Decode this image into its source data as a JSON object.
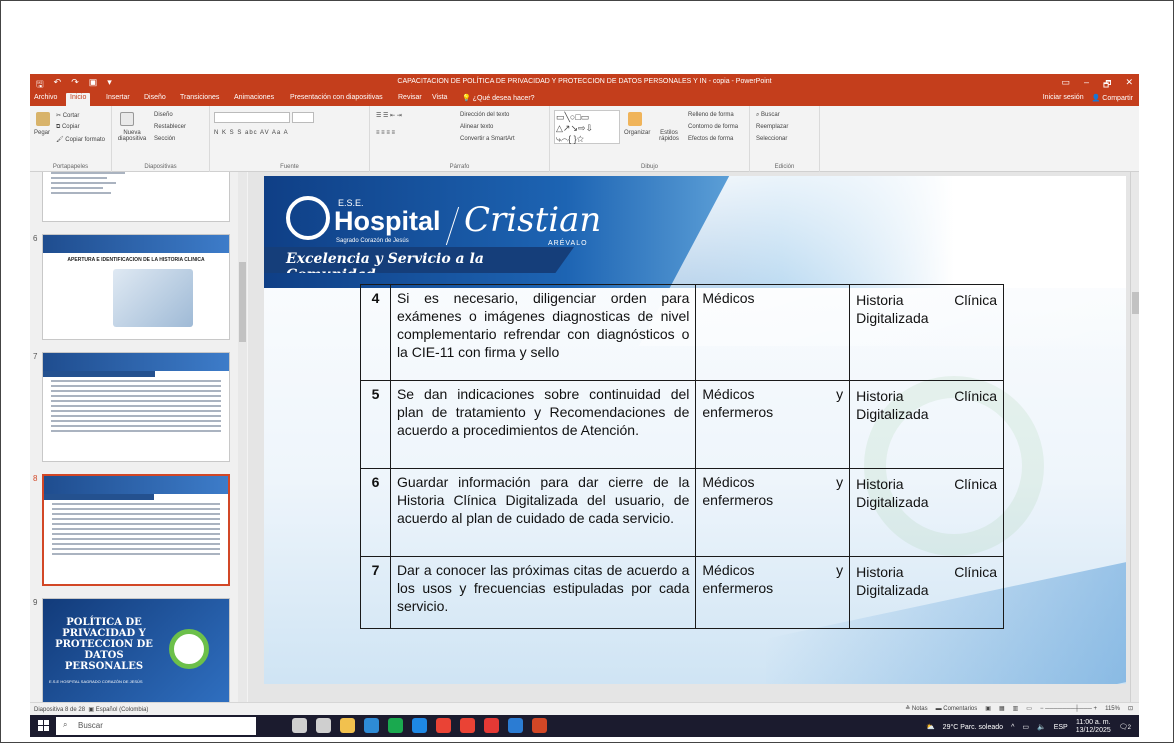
{
  "titlebar": {
    "title": "CAPACITACION DE POLÍTICA DE PRIVACIDAD Y PROTECCION DE DATOS PERSONALES Y IN - copia - PowerPoint",
    "window_controls": [
      "▭",
      "–",
      "🗗",
      "✕"
    ]
  },
  "tabs": {
    "items": [
      "Archivo",
      "Inicio",
      "Insertar",
      "Diseño",
      "Transiciones",
      "Animaciones",
      "Presentación con diapositivas",
      "Revisar",
      "Vista",
      "¿Qué desea hacer?"
    ],
    "signin": "Iniciar sesión",
    "share": "Compartir"
  },
  "ribbon": {
    "clipboard": {
      "paste": "Pegar",
      "cut": "Cortar",
      "copy": "Copiar",
      "format_painter": "Copiar formato",
      "label": "Portapapeles"
    },
    "slides": {
      "new_slide": "Nueva diapositiva",
      "layout": "Diseño",
      "reset": "Restablecer",
      "section": "Sección",
      "label": "Diapositivas"
    },
    "font": {
      "label": "Fuente",
      "format_row": "N K S S abc AV Aa A"
    },
    "paragraph": {
      "label": "Párrafo",
      "text_direction": "Dirección del texto",
      "align_text": "Alinear texto",
      "smartart": "Convertir a SmartArt"
    },
    "drawing": {
      "label": "Dibujo",
      "arrange": "Organizar",
      "quick_styles": "Estilos rápidos",
      "fill": "Relleno de forma",
      "outline": "Contorno de forma",
      "effects": "Efectos de forma"
    },
    "editing": {
      "label": "Edición",
      "find": "Buscar",
      "replace": "Reemplazar",
      "select": "Seleccionar"
    }
  },
  "thumbnails": [
    {
      "num": "6",
      "title": "APERTURA E IDENTIFICACION DE LA HISTORIA CLINICA"
    },
    {
      "num": "7",
      "title": ""
    },
    {
      "num": "8",
      "title": ""
    },
    {
      "num": "9",
      "title": "POLÍTICA DE PRIVACIDAD Y PROTECCION DE DATOS PERSONALES",
      "footer": "E.S.E HOSPITAL SAGRADO CORAZÓN DE JESÚS"
    }
  ],
  "slide": {
    "logo": {
      "ese": "E.S.E.",
      "hospital": "Hospital",
      "subtitle": "Sagrado Corazón de Jesús",
      "script": "Cristian",
      "arevalo": "ARÉVALO"
    },
    "tagline": "Excelencia y Servicio a la Comunidad",
    "rows": [
      {
        "num": "4",
        "activity": "Si es necesario, diligenciar orden para exámenes o imágenes diagnosticas de nivel complementario refrendar con diagnósticos o la CIE-11 con firma y sello",
        "resp_a": "Médicos",
        "resp_b": "",
        "resp_c": "",
        "doc_a": "Historia",
        "doc_b": "Clínica",
        "doc_c": "Digitalizada"
      },
      {
        "num": "5",
        "activity": "Se dan indicaciones sobre continuidad del plan de tratamiento y Recomendaciones de acuerdo a procedimientos de Atención.",
        "resp_a": "Médicos",
        "resp_b": "y",
        "resp_c": "enfermeros",
        "doc_a": "Historia",
        "doc_b": "Clínica",
        "doc_c": "Digitalizada"
      },
      {
        "num": "6",
        "activity": "Guardar información para dar cierre de la Historia Clínica Digitalizada del usuario, de acuerdo al plan de cuidado de cada servicio.",
        "resp_a": "Médicos",
        "resp_b": "y",
        "resp_c": "enfermeros",
        "doc_a": "Historia",
        "doc_b": "Clínica",
        "doc_c": "Digitalizada"
      },
      {
        "num": "7",
        "activity": "Dar a conocer las próximas citas de acuerdo a los usos y frecuencias estipuladas por cada servicio.",
        "resp_a": "Médicos",
        "resp_b": "y",
        "resp_c": "enfermeros",
        "doc_a": "Historia",
        "doc_b": "Clínica",
        "doc_c": "Digitalizada"
      }
    ]
  },
  "statusbar": {
    "slide_info": "Diapositiva 8 de 28",
    "language": "Español (Colombia)",
    "notes": "Notas",
    "comments": "Comentarios",
    "zoom": "115%"
  },
  "taskbar": {
    "search_placeholder": "Buscar",
    "weather": "29°C Parc. soleado",
    "lang": "ESP",
    "time": "11:00 a. m.",
    "date": "13/12/2025",
    "notif_count": "2",
    "app_colors": [
      "#cfcfcf",
      "#cfcfcf",
      "#f2c14e",
      "#2e8bd6",
      "#1aa94f",
      "#1e88e5",
      "#ea4335",
      "#ea4335",
      "#e53935",
      "#2b7cd3",
      "#d24726"
    ]
  },
  "colors": {
    "accent": "#c43e1c",
    "slide_blue": "#153e7a",
    "selected": "#d24726"
  }
}
